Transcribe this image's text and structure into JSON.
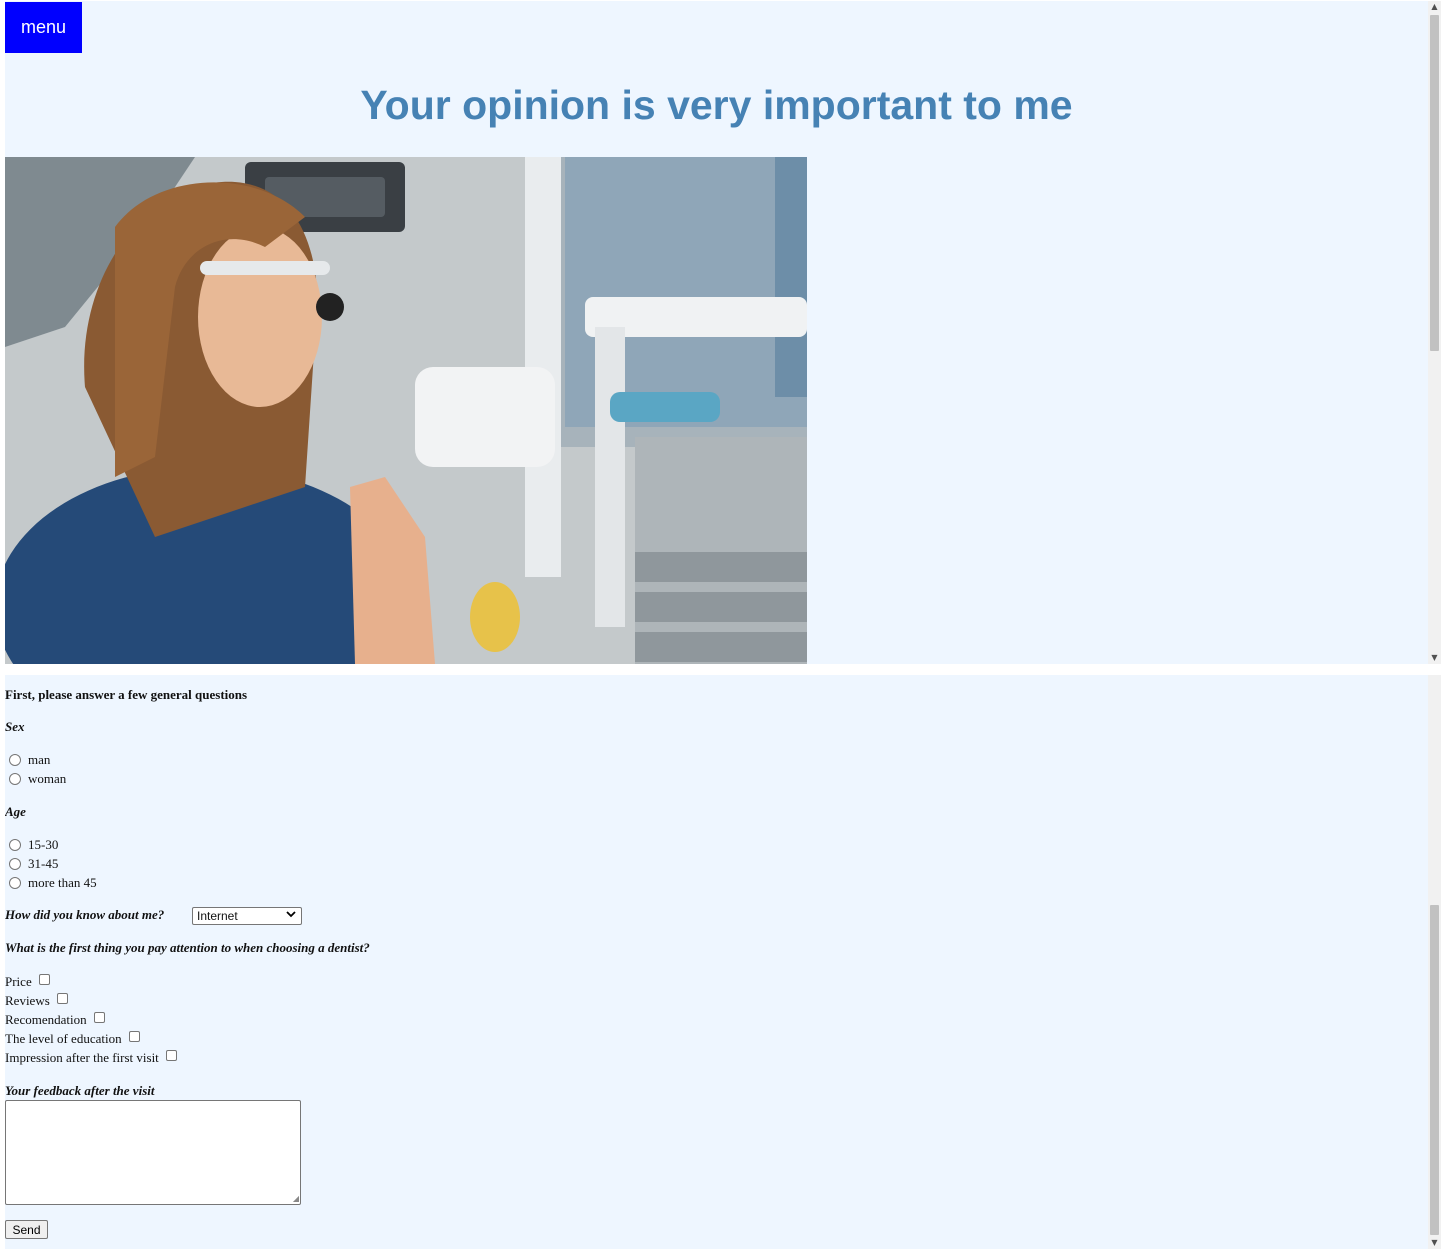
{
  "header": {
    "menu_label": "menu",
    "title": "Your opinion is very important to me"
  },
  "hero_image": {
    "alt": "Dentist with magnifying glasses, hands pressed together"
  },
  "form": {
    "intro": "First, please answer a few general questions",
    "sex": {
      "label": "Sex",
      "options": [
        "man",
        "woman"
      ]
    },
    "age": {
      "label": "Age",
      "options": [
        "15-30",
        "31-45",
        "more than 45"
      ]
    },
    "source": {
      "label": "How did you know about me?",
      "selected": "Internet"
    },
    "attention": {
      "label": "What is the first thing you pay attention to when choosing a dentist?",
      "options": [
        "Price",
        "Reviews",
        "Recomendation",
        "The level of education",
        "Impression after the first visit"
      ]
    },
    "feedback": {
      "label": "Your feedback after the visit",
      "value": ""
    },
    "send_label": "Send"
  },
  "colors": {
    "background": "#eef6ff",
    "title": "#4682b4",
    "menu_button": "#0000ff"
  }
}
